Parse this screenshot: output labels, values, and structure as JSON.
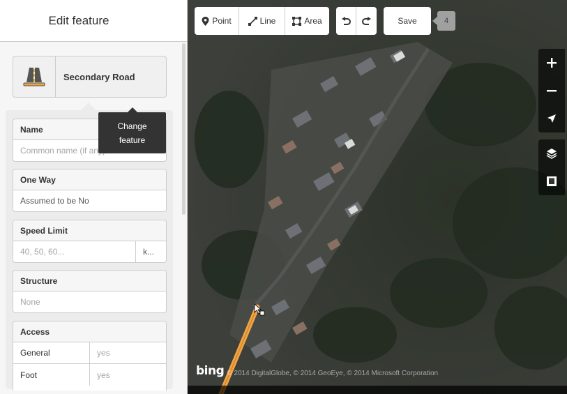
{
  "sidebar": {
    "title": "Edit feature",
    "preset": {
      "label": "Secondary Road",
      "icon": "road-icon"
    },
    "tooltip": {
      "line1": "Change",
      "line2": "feature"
    },
    "fields": {
      "name": {
        "label": "Name",
        "placeholder": "Common name (if any)"
      },
      "oneway": {
        "label": "One Way",
        "value": "Assumed to be No"
      },
      "maxspeed": {
        "label": "Speed Limit",
        "placeholder": "40, 50, 60...",
        "unit": "k..."
      },
      "structure": {
        "label": "Structure",
        "value": "None"
      },
      "access": {
        "label": "Access",
        "rows": [
          {
            "key": "General",
            "value": "yes"
          },
          {
            "key": "Foot",
            "value": "yes"
          }
        ]
      }
    }
  },
  "toolbar": {
    "point_label": "Point",
    "line_label": "Line",
    "area_label": "Area",
    "save_label": "Save",
    "edit_count": "4"
  },
  "map": {
    "attribution_logo": "bing",
    "attribution_text": "© 2014 DigitalGlobe, © 2014 GeoEye, © 2014 Microsoft Corporation",
    "selected_way_color": "#f0a442"
  }
}
